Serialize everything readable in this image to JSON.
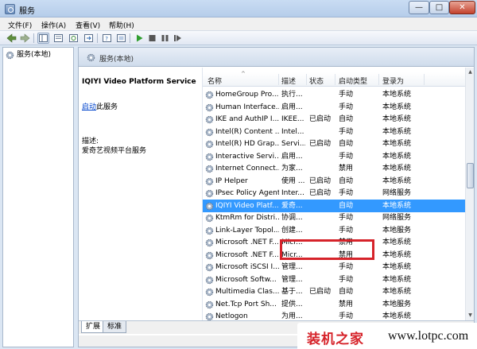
{
  "window": {
    "title": "服务",
    "min_symbol": "—",
    "max_symbol": "□",
    "close_symbol": "✕"
  },
  "menu": [
    "文件(F)",
    "操作(A)",
    "查看(V)",
    "帮助(H)"
  ],
  "toolbar_icons": [
    "back-icon",
    "forward-icon",
    "console-tree-icon",
    "properties-icon",
    "refresh-icon",
    "export-icon",
    "help-icon",
    "view-icon",
    "start-icon",
    "stop-icon",
    "pause-icon",
    "restart-icon"
  ],
  "tree": {
    "item": "服务(本地)"
  },
  "panel": {
    "header": "服务(本地)"
  },
  "details": {
    "service_title": "IQIYI Video Platform Service",
    "start_link": "启动",
    "start_suffix": "此服务",
    "desc_label": "描述:",
    "desc_text": "爱奇艺视频平台服务"
  },
  "columns": [
    "名称",
    "描述",
    "状态",
    "启动类型",
    "登录为"
  ],
  "rows": [
    {
      "name": "HomeGroup Pro...",
      "desc": "执行...",
      "status": "",
      "startup": "手动",
      "logon": "本地系统"
    },
    {
      "name": "Human Interface...",
      "desc": "启用...",
      "status": "",
      "startup": "手动",
      "logon": "本地系统"
    },
    {
      "name": "IKE and AuthIP I...",
      "desc": "IKEE...",
      "status": "已启动",
      "startup": "自动",
      "logon": "本地系统"
    },
    {
      "name": "Intel(R) Content ...",
      "desc": "Intel...",
      "status": "",
      "startup": "手动",
      "logon": "本地系统"
    },
    {
      "name": "Intel(R) HD Grap...",
      "desc": "Servi...",
      "status": "已启动",
      "startup": "自动",
      "logon": "本地系统"
    },
    {
      "name": "Interactive Servi...",
      "desc": "启用...",
      "status": "",
      "startup": "手动",
      "logon": "本地系统"
    },
    {
      "name": "Internet Connect...",
      "desc": "为家...",
      "status": "",
      "startup": "禁用",
      "logon": "本地系统"
    },
    {
      "name": "IP Helper",
      "desc": "使用 ...",
      "status": "已启动",
      "startup": "自动",
      "logon": "本地系统"
    },
    {
      "name": "IPsec Policy Agent",
      "desc": "Inter...",
      "status": "已启动",
      "startup": "手动",
      "logon": "网络服务"
    },
    {
      "name": "IQIYI Video Platf...",
      "desc": "爱奇...",
      "status": "",
      "startup": "自动",
      "logon": "本地系统"
    },
    {
      "name": "KtmRm for Distri...",
      "desc": "协调...",
      "status": "",
      "startup": "手动",
      "logon": "网络服务"
    },
    {
      "name": "Link-Layer Topol...",
      "desc": "创建...",
      "status": "",
      "startup": "手动",
      "logon": "本地服务"
    },
    {
      "name": "Microsoft .NET F...",
      "desc": "Micr...",
      "status": "",
      "startup": "禁用",
      "logon": "本地系统"
    },
    {
      "name": "Microsoft .NET F...",
      "desc": "Micr...",
      "status": "",
      "startup": "禁用",
      "logon": "本地系统"
    },
    {
      "name": "Microsoft iSCSI I...",
      "desc": "管理...",
      "status": "",
      "startup": "手动",
      "logon": "本地系统"
    },
    {
      "name": "Microsoft Softw...",
      "desc": "管理...",
      "status": "",
      "startup": "手动",
      "logon": "本地系统"
    },
    {
      "name": "Multimedia Clas...",
      "desc": "基于...",
      "status": "已启动",
      "startup": "自动",
      "logon": "本地系统"
    },
    {
      "name": "Net.Tcp Port Sh...",
      "desc": "提供...",
      "status": "",
      "startup": "禁用",
      "logon": "本地服务"
    },
    {
      "name": "Netlogon",
      "desc": "为用...",
      "status": "",
      "startup": "手动",
      "logon": "本地系统"
    }
  ],
  "selected_row": 9,
  "tabs": [
    "扩展",
    "标准"
  ],
  "watermark": {
    "name": "装机之家",
    "url": "www.lotpc.com"
  },
  "colors": {
    "selection": "#3399ff",
    "highlight_box": "#d6232a"
  }
}
